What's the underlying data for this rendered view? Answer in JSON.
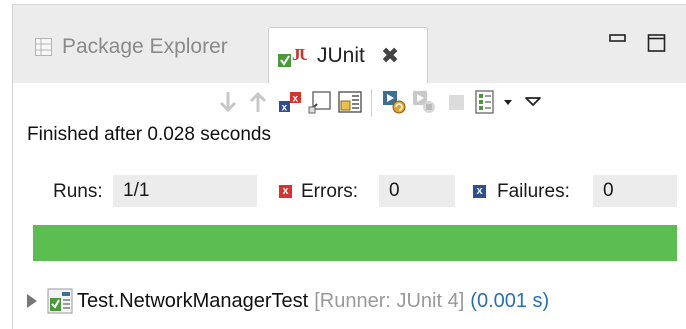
{
  "tabs": {
    "package_explorer": {
      "label": "Package Explorer",
      "icon": "package-explorer-icon"
    },
    "junit": {
      "label": "JUnit",
      "icon": "junit-icon",
      "close_icon": "close-icon",
      "close_glyph": "✖"
    }
  },
  "window_controls": {
    "minimize_icon": "minimize-icon",
    "maximize_icon": "maximize-icon"
  },
  "toolbar": {
    "icons": [
      "next-failure-icon",
      "previous-failure-icon",
      "show-failures-only-icon",
      "scroll-lock-icon",
      "layout-icon",
      "rerun-icon",
      "rerun-failures-first-icon",
      "stop-icon",
      "test-run-history-icon",
      "history-dropdown-icon",
      "view-menu-icon"
    ]
  },
  "status": {
    "text": "Finished after 0.028 seconds"
  },
  "counters": {
    "runs_label": "Runs:",
    "runs_value": "1/1",
    "errors_label": "Errors:",
    "errors_value": "0",
    "failures_label": "Failures:",
    "failures_value": "0"
  },
  "progress": {
    "fraction": 1.0,
    "color": "#5cbd50",
    "status": "success"
  },
  "results_tree": {
    "items": [
      {
        "name": "Test.NetworkManagerTest",
        "runner": "[Runner: JUnit 4]",
        "elapsed": "(0.001 s)",
        "icon": "test-suite-passed-icon",
        "expanded": false
      }
    ]
  },
  "colors": {
    "error": "#d9322f",
    "failure": "#2f4f8f",
    "success": "#5cbd50",
    "elapsed_text": "#2a6fb5"
  }
}
